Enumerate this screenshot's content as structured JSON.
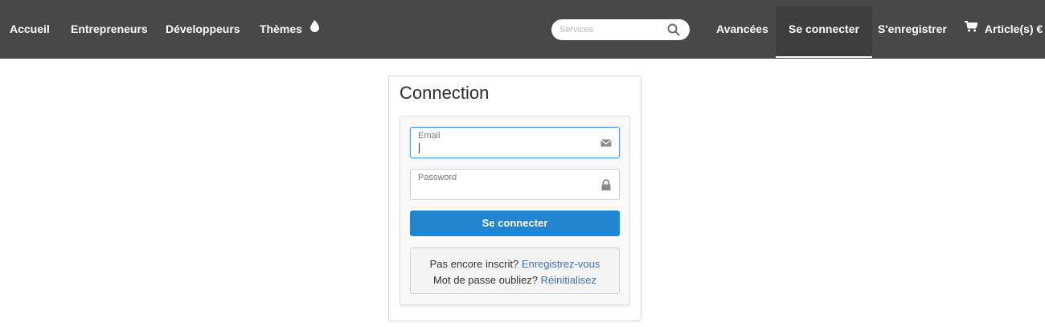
{
  "nav": {
    "left_items": [
      {
        "label": "Accueil"
      },
      {
        "label": "Entrepreneurs"
      },
      {
        "label": "Développeurs"
      },
      {
        "label": "Thèmes"
      }
    ],
    "search": {
      "placeholder": "Services"
    },
    "right_items": [
      {
        "label": "Avancées"
      },
      {
        "label": "Se connecter",
        "active": true
      },
      {
        "label": "S'enregistrer"
      }
    ],
    "cart": {
      "label": "Article(s) €"
    }
  },
  "login": {
    "title": "Connection",
    "email": {
      "label": "Email",
      "value": ""
    },
    "password": {
      "label": "Password",
      "value": ""
    },
    "submit_label": "Se connecter",
    "register": {
      "question": "Pas encore inscrit?",
      "link": "Enregistrez-vous"
    },
    "reset": {
      "question": "Mot de passe oubliez?",
      "link": "Réinitialisez"
    }
  },
  "icons": {
    "themes": "droplet-icon",
    "search": "search-icon",
    "cart": "cart-icon",
    "email": "envelope-icon",
    "password": "lock-icon"
  },
  "colors": {
    "navbar": "#484848",
    "primary_button": "#2185d0",
    "link": "#3f72b5",
    "focus_border": "#5b9bd5"
  }
}
